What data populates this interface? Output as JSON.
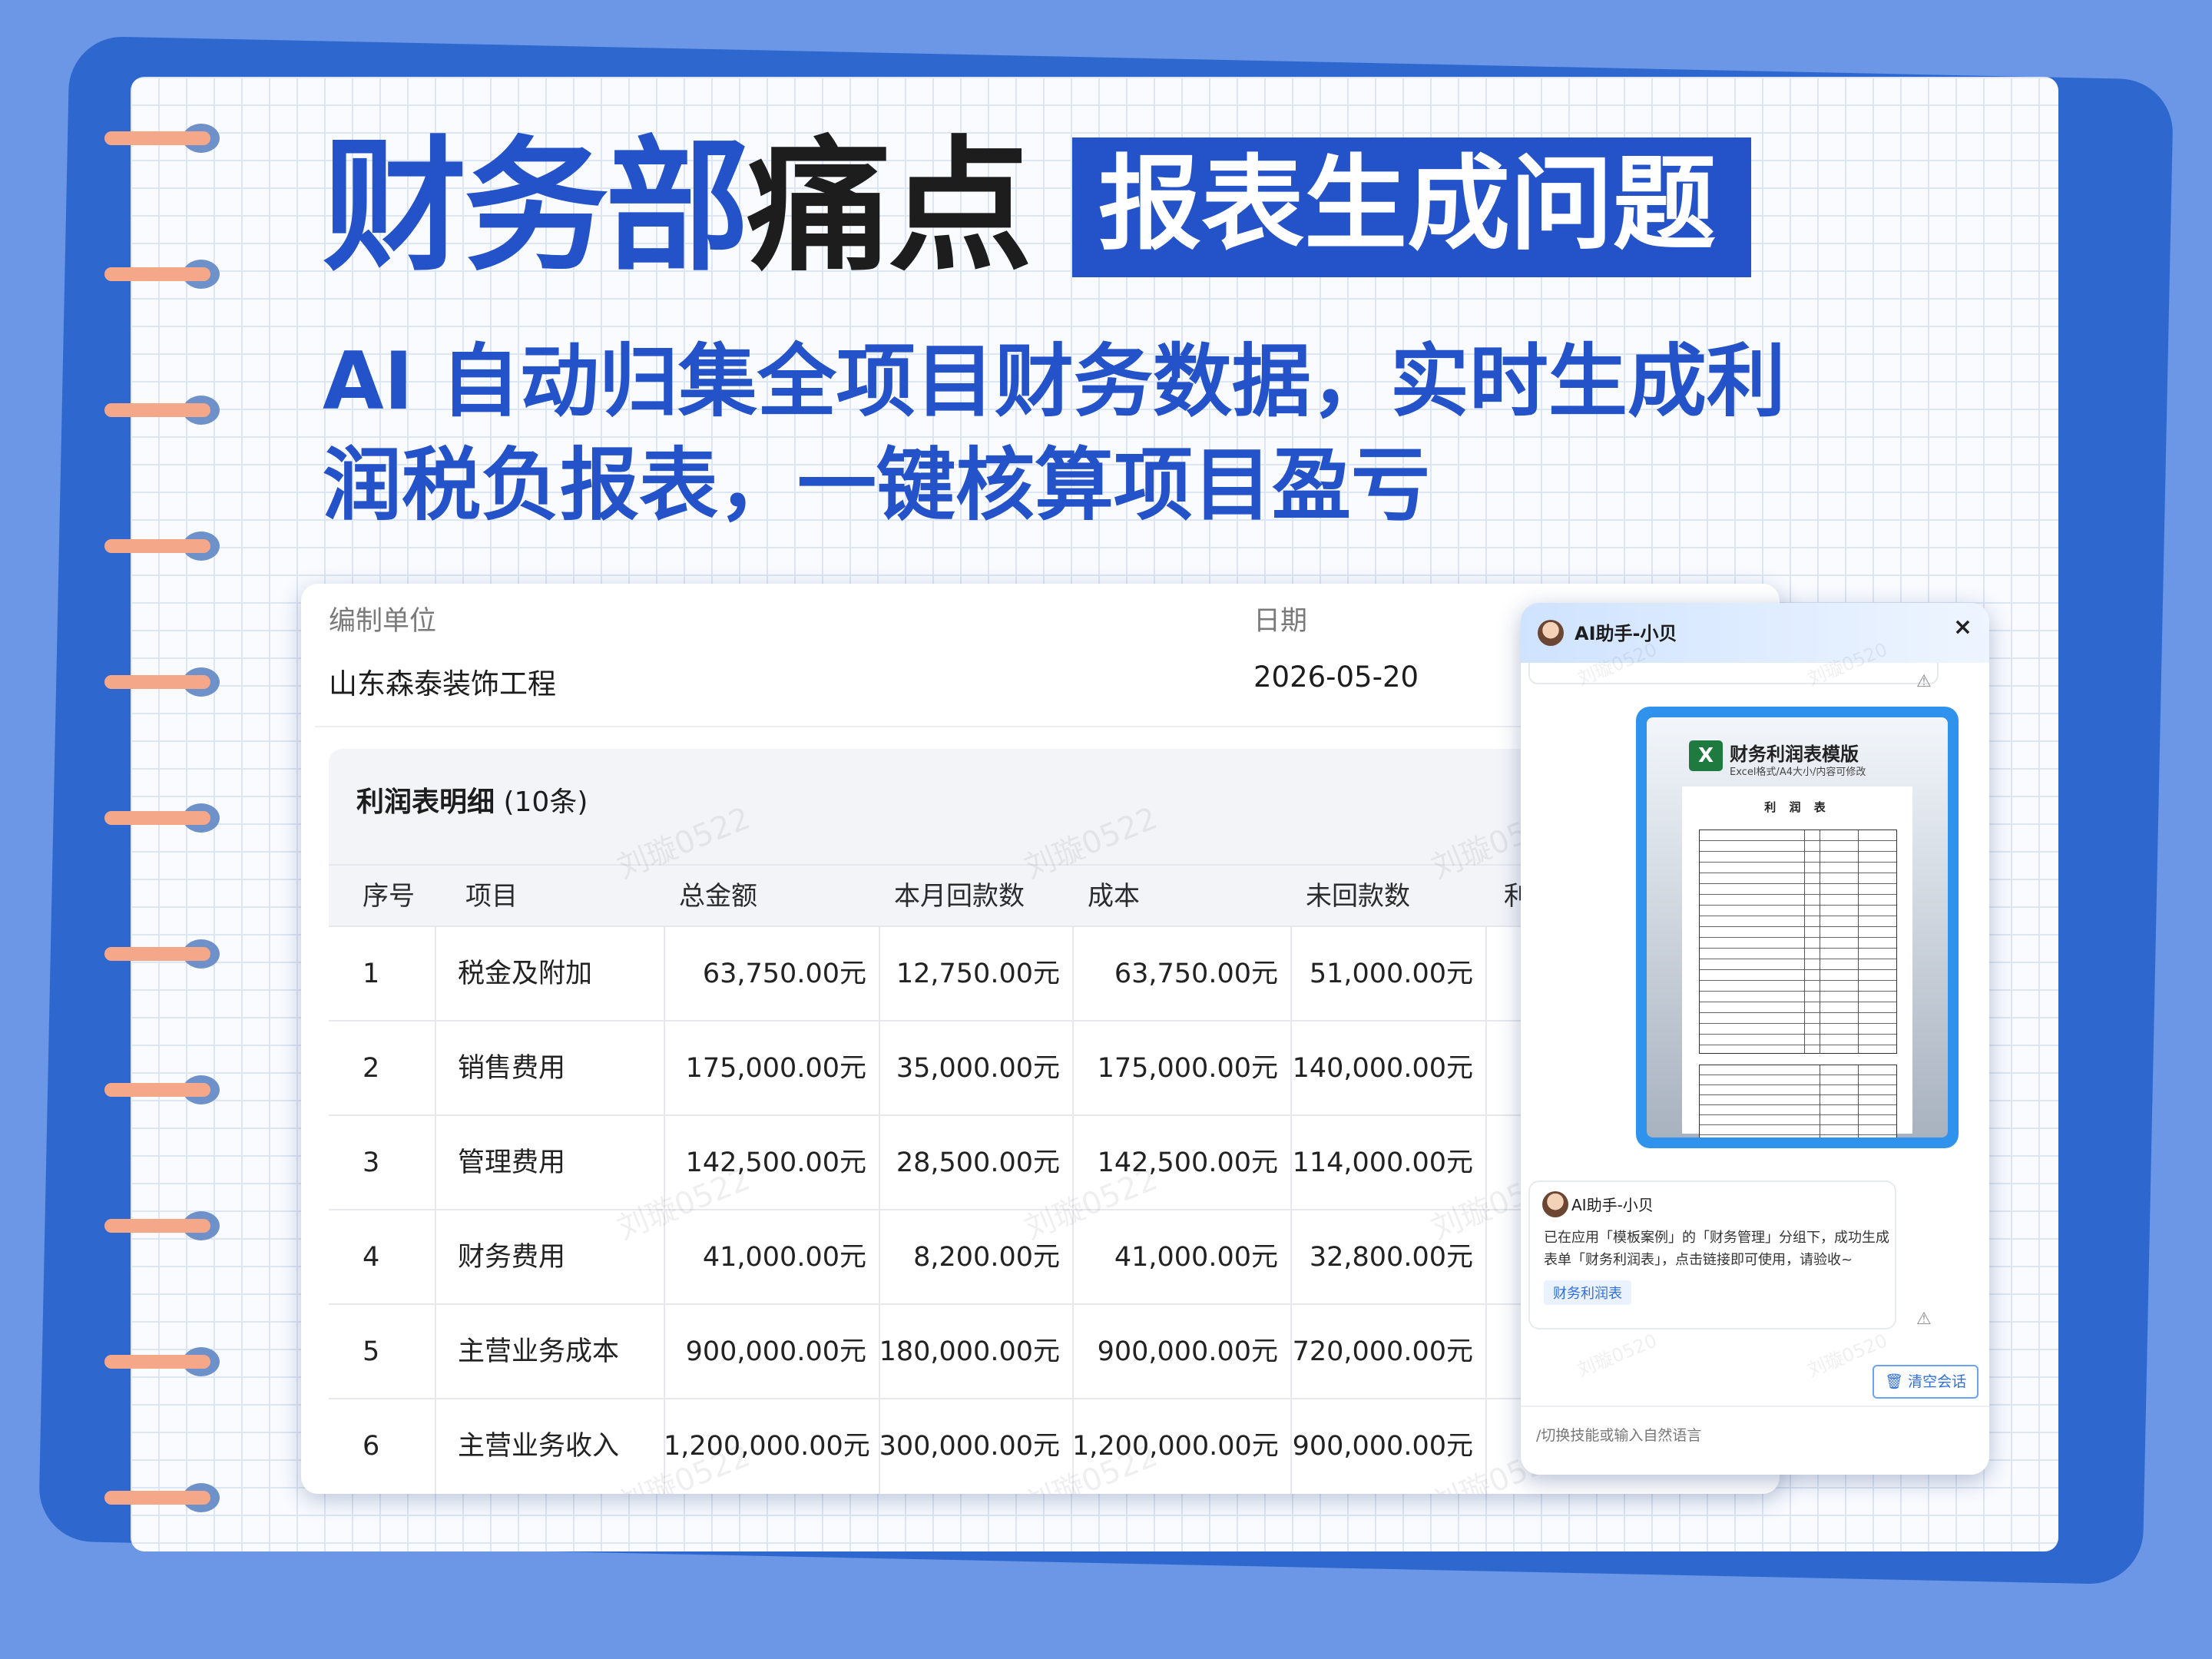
{
  "headline": {
    "part_blue": "财务部",
    "part_dark": "痛点",
    "tag": "报表生成问题"
  },
  "subtitle": {
    "line1": "AI 自动归集全项目财务数据，实时生成利",
    "line2": "润税负报表，一键核算项目盈亏"
  },
  "report": {
    "unit_label": "编制单位",
    "unit_value": "山东森泰装饰工程",
    "date_label": "日期",
    "date_value": "2026-05-20",
    "section_title": "利润表明细",
    "section_count": "(10条)",
    "columns": [
      "序号",
      "项目",
      "总金额",
      "本月回款数",
      "成本",
      "未回款数",
      "利"
    ],
    "rows": [
      {
        "no": "1",
        "item": "税金及附加",
        "total": "63,750.00元",
        "month_back": "12,750.00元",
        "cost": "63,750.00元",
        "unpaid": "51,000.00元"
      },
      {
        "no": "2",
        "item": "销售费用",
        "total": "175,000.00元",
        "month_back": "35,000.00元",
        "cost": "175,000.00元",
        "unpaid": "140,000.00元"
      },
      {
        "no": "3",
        "item": "管理费用",
        "total": "142,500.00元",
        "month_back": "28,500.00元",
        "cost": "142,500.00元",
        "unpaid": "114,000.00元"
      },
      {
        "no": "4",
        "item": "财务费用",
        "total": "41,000.00元",
        "month_back": "8,200.00元",
        "cost": "41,000.00元",
        "unpaid": "32,800.00元"
      },
      {
        "no": "5",
        "item": "主营业务成本",
        "total": "900,000.00元",
        "month_back": "180,000.00元",
        "cost": "900,000.00元",
        "unpaid": "720,000.00元"
      },
      {
        "no": "6",
        "item": "主营业务收入",
        "total": "1,200,000.00元",
        "month_back": "300,000.00元",
        "cost": "1,200,000.00元",
        "unpaid": "900,000.00元"
      }
    ],
    "watermark": "刘璇0522"
  },
  "assistant": {
    "title": "AI助手-小贝",
    "close": "×",
    "warn_icon": "⚠",
    "watermark": "刘璇0520",
    "doc": {
      "icon": "X",
      "title": "财务利润表模版",
      "subtitle": "Excel格式/A4大小/内容可修改",
      "sheet_title": "利 润 表"
    },
    "message": {
      "sender": "AI助手-小贝",
      "text": "已在应用「模板案例」的「财务管理」分组下，成功生成表单「财务利润表」，点击链接即可使用，请验收~",
      "link": "财务利润表"
    },
    "clear_button": "清空会话",
    "input_placeholder": "/切换技能或输入自然语言"
  },
  "colors": {
    "background": "#6b97e6",
    "brand_blue": "#2452c9",
    "ring": "#f5a889"
  }
}
